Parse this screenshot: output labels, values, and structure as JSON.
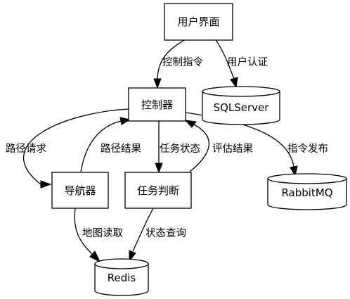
{
  "nodes": {
    "ui": "用户界面",
    "controller": "控制器",
    "sqlserver": "SQLServer",
    "navigator": "导航器",
    "task_judge": "任务判断",
    "rabbitmq": "RabbitMQ",
    "redis": "Redis"
  },
  "edges": {
    "ui_to_controller": "控制指令",
    "ui_to_sqlserver": "用户认证",
    "controller_to_navigator": "路径请求",
    "navigator_to_controller": "路径结果",
    "controller_to_task": "任务状态",
    "task_to_controller": "评估结果",
    "controller_to_rabbitmq": "指令发布",
    "navigator_to_redis": "地图读取",
    "task_to_redis": "状态查询"
  }
}
